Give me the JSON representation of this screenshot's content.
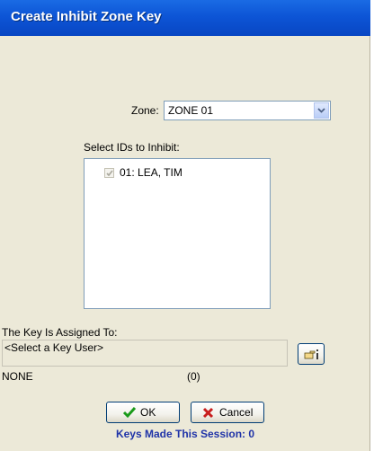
{
  "window": {
    "title": "Create Inhibit Zone Key"
  },
  "zone": {
    "label": "Zone:",
    "value": "ZONE 01"
  },
  "ids": {
    "label": "Select IDs to Inhibit:",
    "items": [
      {
        "label": "01: LEA, TIM",
        "checked": true
      }
    ]
  },
  "key_assignment": {
    "label": "The Key Is Assigned To:",
    "placeholder": "<Select a Key User>",
    "user": "NONE",
    "count": "(0)"
  },
  "buttons": {
    "ok": "OK",
    "cancel": "Cancel"
  },
  "session": {
    "text": "Keys Made This Session: 0"
  },
  "colors": {
    "title_bar": "#0d55d6",
    "dialog_bg": "#ece9d8",
    "session_text": "#1f33a8",
    "ok_check": "#1a9a1a",
    "cancel_x": "#c81e1e"
  },
  "icons": {
    "combo": "chevron-down-icon",
    "select_user": "pointing-hand-icon",
    "ok": "green-check-icon",
    "cancel": "red-x-icon"
  }
}
